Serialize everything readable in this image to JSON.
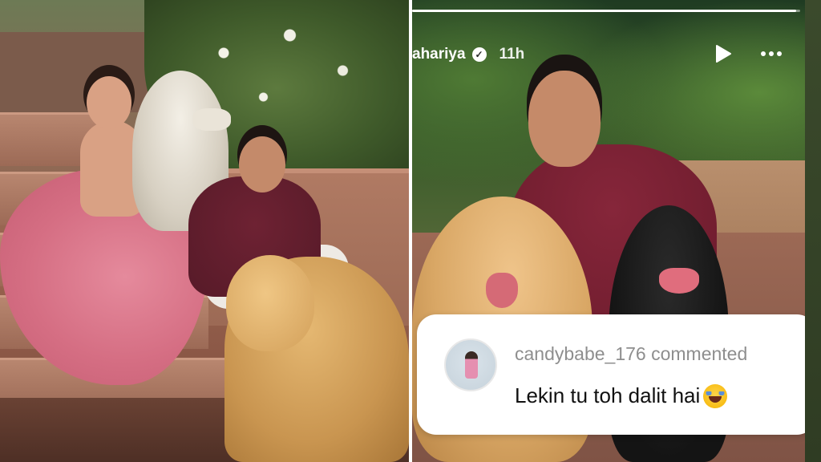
{
  "story": {
    "username": "ahariya",
    "time": "11h",
    "progress": 0.99,
    "icons": {
      "verified": "verified-badge-icon",
      "play": "play-icon",
      "more": "more-options-icon"
    }
  },
  "comment": {
    "user_line": "candybabe_176 commented",
    "text": "Lekin tu toh dalit hai",
    "emoji": "face-with-tears-of-joy-icon"
  }
}
